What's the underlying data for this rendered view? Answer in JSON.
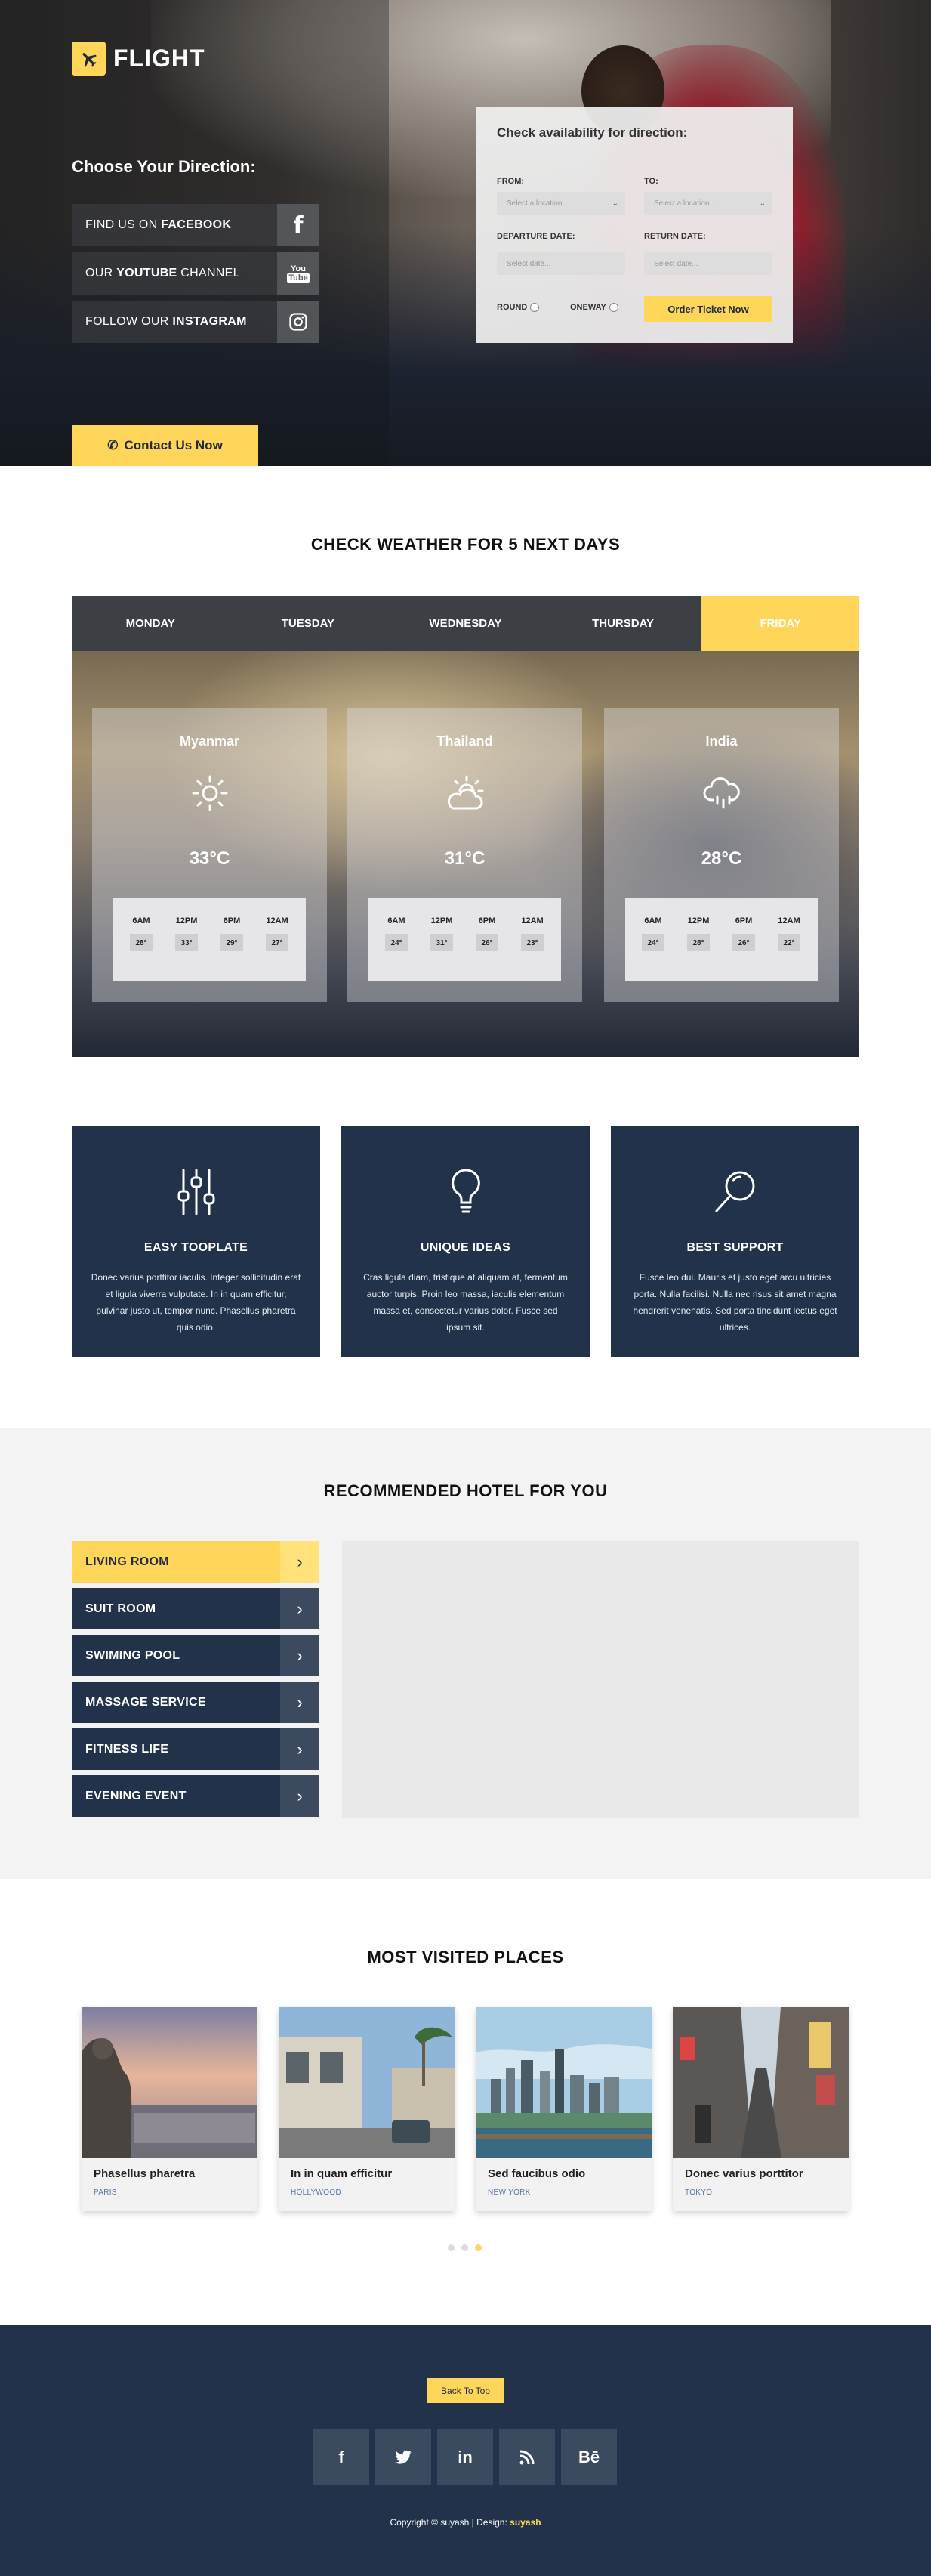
{
  "brand": {
    "name": "FLIGHT",
    "accent": "#ffd659",
    "dark": "#21324a"
  },
  "hero": {
    "direction_title": "Choose Your Direction:",
    "social": [
      {
        "prefix": "FIND US ON ",
        "bold": "FACEBOOK",
        "suffix": "",
        "icon": "facebook-icon",
        "glyph": "f"
      },
      {
        "prefix": "OUR ",
        "bold": "YOUTUBE",
        "suffix": " CHANNEL",
        "icon": "youtube-icon",
        "glyph": "You Tube"
      },
      {
        "prefix": "FOLLOW OUR ",
        "bold": "INSTAGRAM",
        "suffix": "",
        "icon": "instagram-icon",
        "glyph": "◎"
      }
    ],
    "contact_label": "Contact Us Now"
  },
  "booking": {
    "title": "Check availability for direction:",
    "from_label": "FROM:",
    "to_label": "TO:",
    "location_placeholder": "Select a location...",
    "departure_label": "DEPARTURE DATE:",
    "return_label": "RETURN DATE:",
    "date_placeholder": "Select date...",
    "round_label": "ROUND",
    "oneway_label": "ONEWAY",
    "order_label": "Order Ticket Now"
  },
  "weather": {
    "title": "CHECK WEATHER FOR 5 NEXT DAYS",
    "tabs": [
      "MONDAY",
      "TUESDAY",
      "WEDNESDAY",
      "THURSDAY",
      "FRIDAY"
    ],
    "active_tab": "FRIDAY",
    "hours": [
      "6AM",
      "12PM",
      "6PM",
      "12AM"
    ],
    "cities": [
      {
        "city": "Myanmar",
        "temp": "33°C",
        "icon": "sun-icon",
        "readings": [
          "28°",
          "33°",
          "29°",
          "27°"
        ]
      },
      {
        "city": "Thailand",
        "temp": "31°C",
        "icon": "sun-cloud-icon",
        "readings": [
          "24°",
          "31°",
          "26°",
          "23°"
        ]
      },
      {
        "city": "India",
        "temp": "28°C",
        "icon": "rain-cloud-icon",
        "readings": [
          "24°",
          "28°",
          "26°",
          "22°"
        ]
      }
    ]
  },
  "features": [
    {
      "title": "EASY TOOPLATE",
      "icon": "sliders-icon",
      "text": "Donec varius porttitor iaculis. Integer sollicitudin erat et ligula viverra vulputate. In in quam efficitur, pulvinar justo ut, tempor nunc. Phasellus pharetra quis odio."
    },
    {
      "title": "UNIQUE IDEAS",
      "icon": "lightbulb-icon",
      "text": "Cras ligula diam, tristique at aliquam at, fermentum auctor turpis. Proin leo massa, iaculis elementum massa et, consectetur varius dolor. Fusce sed ipsum sit."
    },
    {
      "title": "BEST SUPPORT",
      "icon": "magnifier-icon",
      "text": "Fusce leo dui. Mauris et justo eget arcu ultricies porta. Nulla facilisi. Nulla nec risus sit amet magna hendrerit venenatis. Sed porta tincidunt lectus eget ultrices."
    }
  ],
  "hotel": {
    "title": "RECOMMENDED HOTEL FOR YOU",
    "items": [
      "LIVING ROOM",
      "SUIT ROOM",
      "SWIMING POOL",
      "MASSAGE SERVICE",
      "FITNESS LIFE",
      "EVENING EVENT"
    ],
    "active_item": "LIVING ROOM"
  },
  "places": {
    "title": "MOST VISITED PLACES",
    "items": [
      {
        "name": "Phasellus pharetra",
        "city": "PARIS"
      },
      {
        "name": "In in quam efficitur",
        "city": "HOLLYWOOD"
      },
      {
        "name": "Sed faucibus odio",
        "city": "NEW YORK"
      },
      {
        "name": "Donec varius porttitor",
        "city": "TOKYO"
      }
    ],
    "carousel_page": 3,
    "carousel_pages": 3
  },
  "footer": {
    "back_to_top": "Back To Top",
    "socials": [
      {
        "icon": "facebook-icon",
        "glyph": "f"
      },
      {
        "icon": "twitter-icon",
        "glyph": "🐦"
      },
      {
        "icon": "linkedin-icon",
        "glyph": "in"
      },
      {
        "icon": "rss-icon",
        "glyph": "◔"
      },
      {
        "icon": "behance-icon",
        "glyph": "Bē"
      }
    ],
    "copyright": "Copyright © suyash | Design:",
    "designer": "suyash"
  }
}
